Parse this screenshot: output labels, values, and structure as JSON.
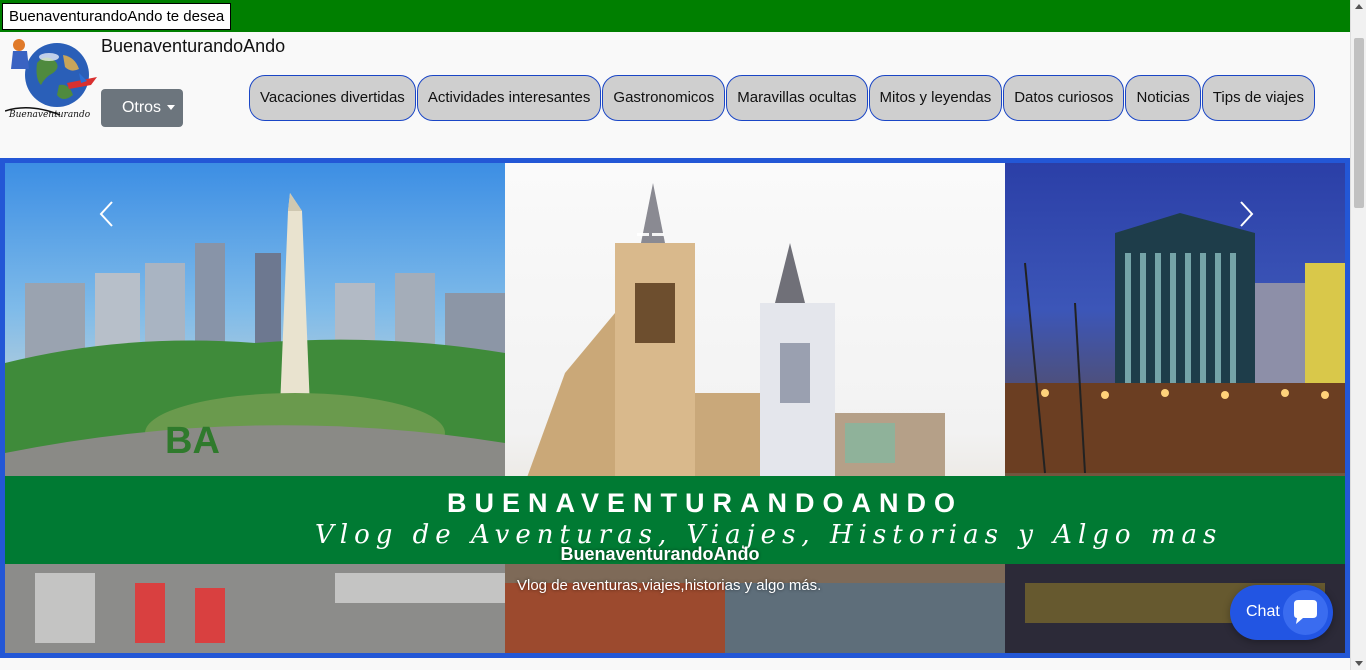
{
  "topbar": {
    "marquee_text": "BuenaventurandoAndo te desea",
    "color": "#007f00"
  },
  "header": {
    "logo_text": "Buenaventurando",
    "site_title": "BuenaventurandoAndo",
    "otros_label": "Otros"
  },
  "nav": {
    "items": [
      {
        "label": "Vacaciones divertidas"
      },
      {
        "label": "Actividades interesantes"
      },
      {
        "label": "Gastronomicos"
      },
      {
        "label": "Maravillas ocultas"
      },
      {
        "label": "Mitos y leyendas"
      },
      {
        "label": "Datos curiosos"
      },
      {
        "label": "Noticias"
      },
      {
        "label": "Tips de viajes"
      }
    ]
  },
  "hero": {
    "banner_title": "BUENAVENTURANDOANDO",
    "banner_subtitle": "Vlog de Aventuras, Viajes, Historias y Algo mas",
    "caption_title": "BuenaventurandoAndo",
    "caption_text": "Vlog de aventuras,viajes,historias y algo más.",
    "frame_color": "#2357d6",
    "banner_color": "#007a33"
  },
  "chat": {
    "label": "Chat",
    "color": "#2255e3"
  },
  "icons": {
    "prev": "chevron-left-icon",
    "next": "chevron-right-icon",
    "chat": "chat-bubble-icon"
  }
}
